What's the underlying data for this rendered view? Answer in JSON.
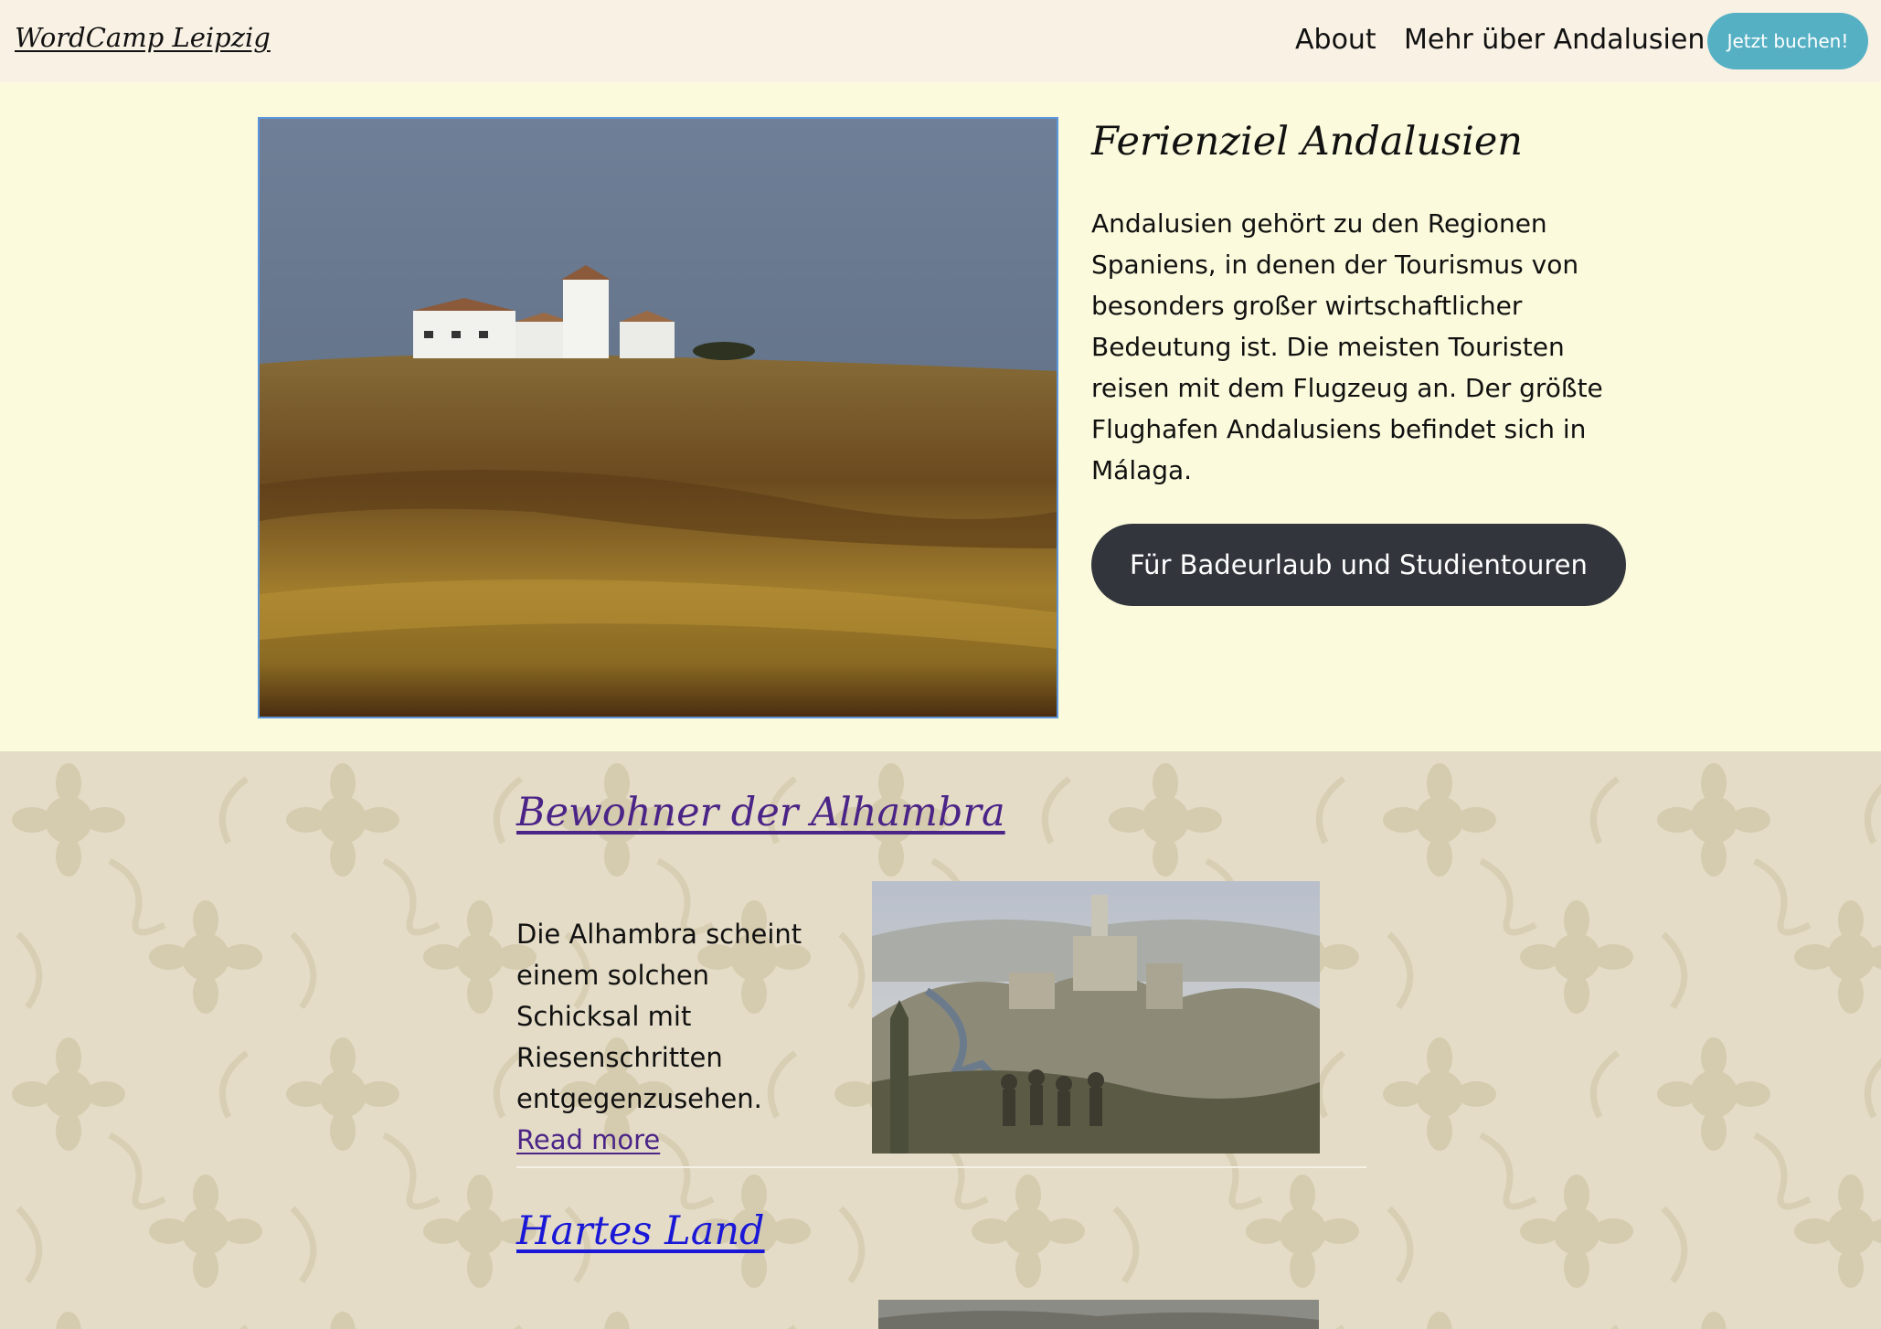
{
  "header": {
    "site_title": "WordCamp Leipzig",
    "nav": [
      "About",
      "Mehr über Andalusien"
    ],
    "book_button": "Jetzt buchen!"
  },
  "hero": {
    "title": "Ferienziel Andalusien",
    "body": "Andalusien gehört zu den Regionen Spaniens, in denen der Tourismus von besonders großer wirtschaftlicher Bedeutung ist. Die meisten Touristen reisen mit dem Flugzeug an. Der größte Flughafen Andalusiens befindet sich in Málaga.",
    "cta": "Für Badeurlaub und Studientouren"
  },
  "posts": [
    {
      "title": "Bewohner der Alhambra",
      "excerpt": "Die Alhambra scheint einem solchen Schicksal mit Riesenschritten entgegenzusehen.",
      "read_more": "Read more"
    },
    {
      "title": "Hartes Land"
    }
  ],
  "colors": {
    "header_bg": "#f8f1e4",
    "hero_bg": "#fbfadc",
    "book_button": "#56b0c4",
    "cta_button": "#32363c",
    "visited_link": "#4b2487",
    "link": "#1a18d6"
  }
}
